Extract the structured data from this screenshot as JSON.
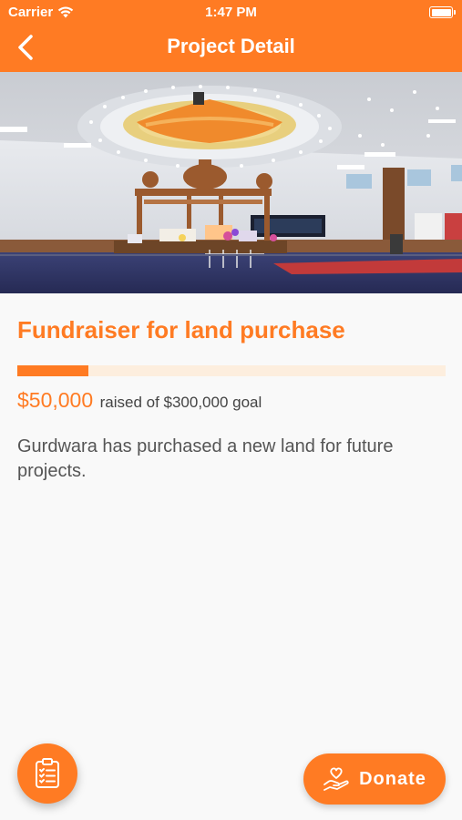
{
  "status_bar": {
    "carrier": "Carrier",
    "time": "1:47 PM"
  },
  "nav": {
    "title": "Project Detail"
  },
  "project": {
    "title": "Fundraiser for land purchase",
    "raised_amount": "$50,000",
    "raised_text": "raised of $300,000 goal",
    "progress_fraction": 0.1667,
    "description": "Gurdwara has purchased a new land for future projects."
  },
  "actions": {
    "donate_label": "Donate"
  },
  "icons": {
    "back": "back-chevron-icon",
    "fab": "clipboard-list-icon",
    "donate": "heart-hand-icon"
  },
  "colors": {
    "accent": "#ff7b23",
    "progress_track": "#fdeede"
  }
}
